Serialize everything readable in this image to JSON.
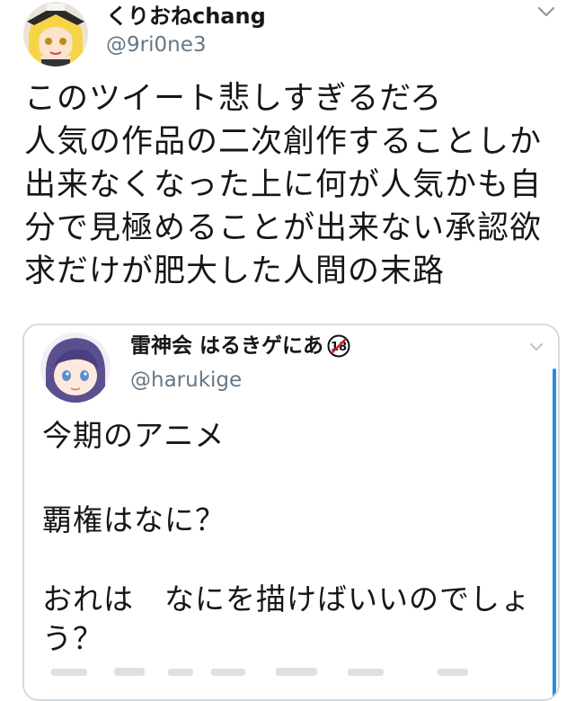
{
  "tweet": {
    "display_name": "くりおねchang",
    "handle": "@9ri0ne3",
    "avatar_icon": "user-avatar-icon",
    "menu_icon": "chevron-down-icon",
    "text_lines": [
      "このツイート悲しすぎるだろ",
      "人気の作品の二次創作することしか",
      "出来なくなった上に何が人気かも自",
      "分で見極めることが出来ない承認欲",
      "求だけが肥大した人間の末路"
    ]
  },
  "quoted_tweet": {
    "display_name": "雷神会 はるきゲにあ",
    "badge": "18",
    "handle": "@harukige",
    "avatar_icon": "user-avatar-icon",
    "menu_icon": "chevron-down-icon",
    "text_lines": [
      "今期のアニメ",
      "覇権はなに？",
      "おれは　なにを描けばいいのでしょ",
      "う？"
    ]
  },
  "colors": {
    "text": "#14171a",
    "secondary": "#657786",
    "border": "#d3dbe1",
    "accent": "#2b8cdc"
  }
}
